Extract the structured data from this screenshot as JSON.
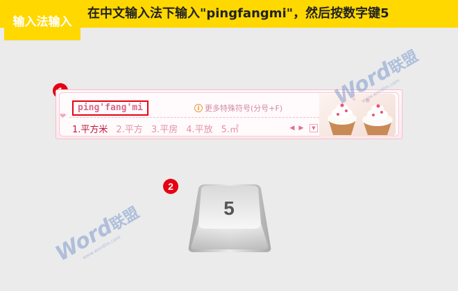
{
  "header": {
    "tag": "输入法输入",
    "instruction": "在中文输入法下输入\"pingfangmi\"，然后按数字键5"
  },
  "steps": [
    "1",
    "2"
  ],
  "ime": {
    "composition": "ping'fang'mi",
    "hint_icon": "i",
    "hint": "更多特殊符号(分号+F)",
    "candidates": [
      "1.平方米",
      "2.平方",
      "3.平房",
      "4.平放",
      "5.㎡"
    ],
    "pager": {
      "prev": "◀",
      "next": "▶",
      "menu": "▼"
    },
    "decor": "heart-icon"
  },
  "key": {
    "label": "5"
  },
  "watermark": {
    "word": "Word",
    "cn": "联盟",
    "url": "www.wordlm.com"
  },
  "colors": {
    "banner": "#ffd800",
    "badge": "#e60012",
    "highlight": "#e60012",
    "candidate_active": "#c0163f",
    "candidate": "#e292ab"
  }
}
